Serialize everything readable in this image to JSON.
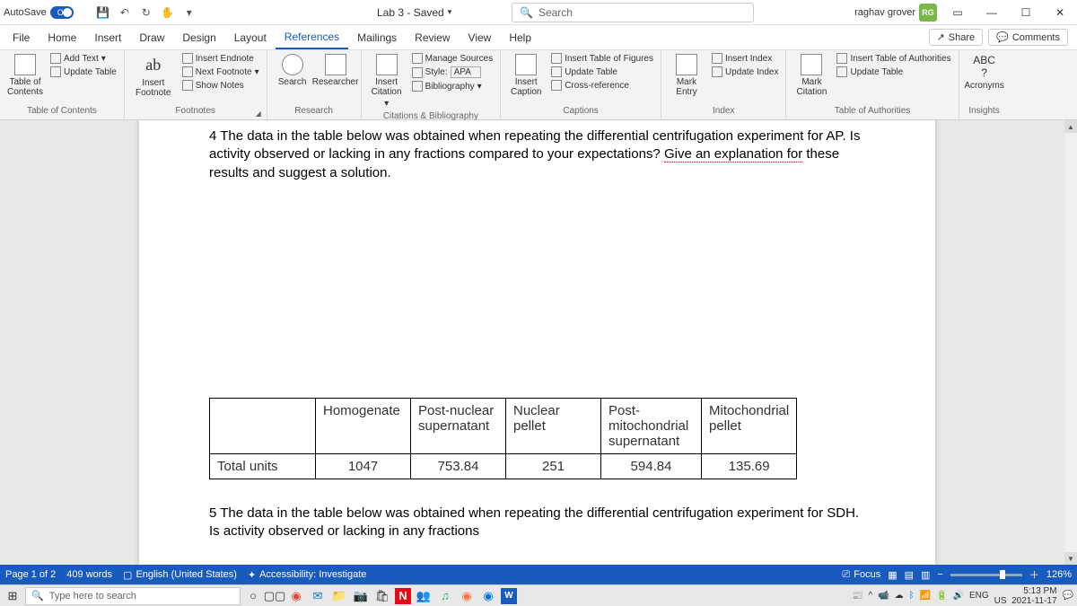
{
  "titlebar": {
    "autosave_label": "AutoSave",
    "autosave_state": "On",
    "doc_title": "Lab 3 - Saved",
    "search_placeholder": "Search",
    "user_name": "raghav grover",
    "user_initials": "RG"
  },
  "tabs": {
    "items": [
      "File",
      "Home",
      "Insert",
      "Draw",
      "Design",
      "Layout",
      "References",
      "Mailings",
      "Review",
      "View",
      "Help"
    ],
    "active_index": 6,
    "share": "Share",
    "comments": "Comments"
  },
  "ribbon": {
    "toc": {
      "big": "Table of Contents",
      "add_text": "Add Text",
      "update": "Update Table",
      "label": "Table of Contents"
    },
    "footnotes": {
      "ab": "ab",
      "insert_footnote": "Insert Footnote",
      "insert_endnote": "Insert Endnote",
      "next_footnote": "Next Footnote",
      "show_notes": "Show Notes",
      "label": "Footnotes"
    },
    "research": {
      "search": "Search",
      "researcher": "Researcher",
      "label": "Research"
    },
    "citations": {
      "insert_citation": "Insert Citation",
      "manage_sources": "Manage Sources",
      "style_label": "Style:",
      "style_value": "APA",
      "bibliography": "Bibliography",
      "label": "Citations & Bibliography"
    },
    "captions": {
      "insert_caption": "Insert Caption",
      "insert_tof": "Insert Table of Figures",
      "update_table": "Update Table",
      "cross_ref": "Cross-reference",
      "label": "Captions"
    },
    "index": {
      "mark_entry": "Mark Entry",
      "insert_index": "Insert Index",
      "update_index": "Update Index",
      "label": "Index"
    },
    "authorities": {
      "mark_citation": "Mark Citation",
      "insert_toa": "Insert Table of Authorities",
      "update_table": "Update Table",
      "label": "Table of Authorities"
    },
    "insights": {
      "acronyms": "Acronyms",
      "abc": "ABC",
      "q": "?",
      "label": "Insights"
    }
  },
  "document": {
    "para4_prefix": "4 The data in the table below was obtained when repeating the differential centrifugation experiment for AP. Is activity observed or lacking in any fractions compared to your expectations? ",
    "para4_underlined": "Give an explanation for",
    "para4_suffix": " these results and suggest a solution.",
    "table": {
      "headers": [
        "",
        "Homogenate",
        "Post-nuclear supernatant",
        "Nuclear pellet",
        "Post-mitochondrial supernatant",
        "Mitochondrial pellet"
      ],
      "row_label": "Total units",
      "values": [
        "1047",
        "753.84",
        "251",
        "594.84",
        "135.69"
      ]
    },
    "para5": "5 The data in the table below was obtained when repeating the differential centrifugation experiment for SDH. Is activity observed or lacking in any fractions"
  },
  "statusbar": {
    "page": "Page 1 of 2",
    "words": "409 words",
    "language": "English (United States)",
    "accessibility": "Accessibility: Investigate",
    "focus": "Focus",
    "zoom": "126%"
  },
  "taskbar": {
    "search_placeholder": "Type here to search",
    "lang": "ENG",
    "region": "US",
    "time": "5:13 PM",
    "date": "2021-11-17"
  }
}
